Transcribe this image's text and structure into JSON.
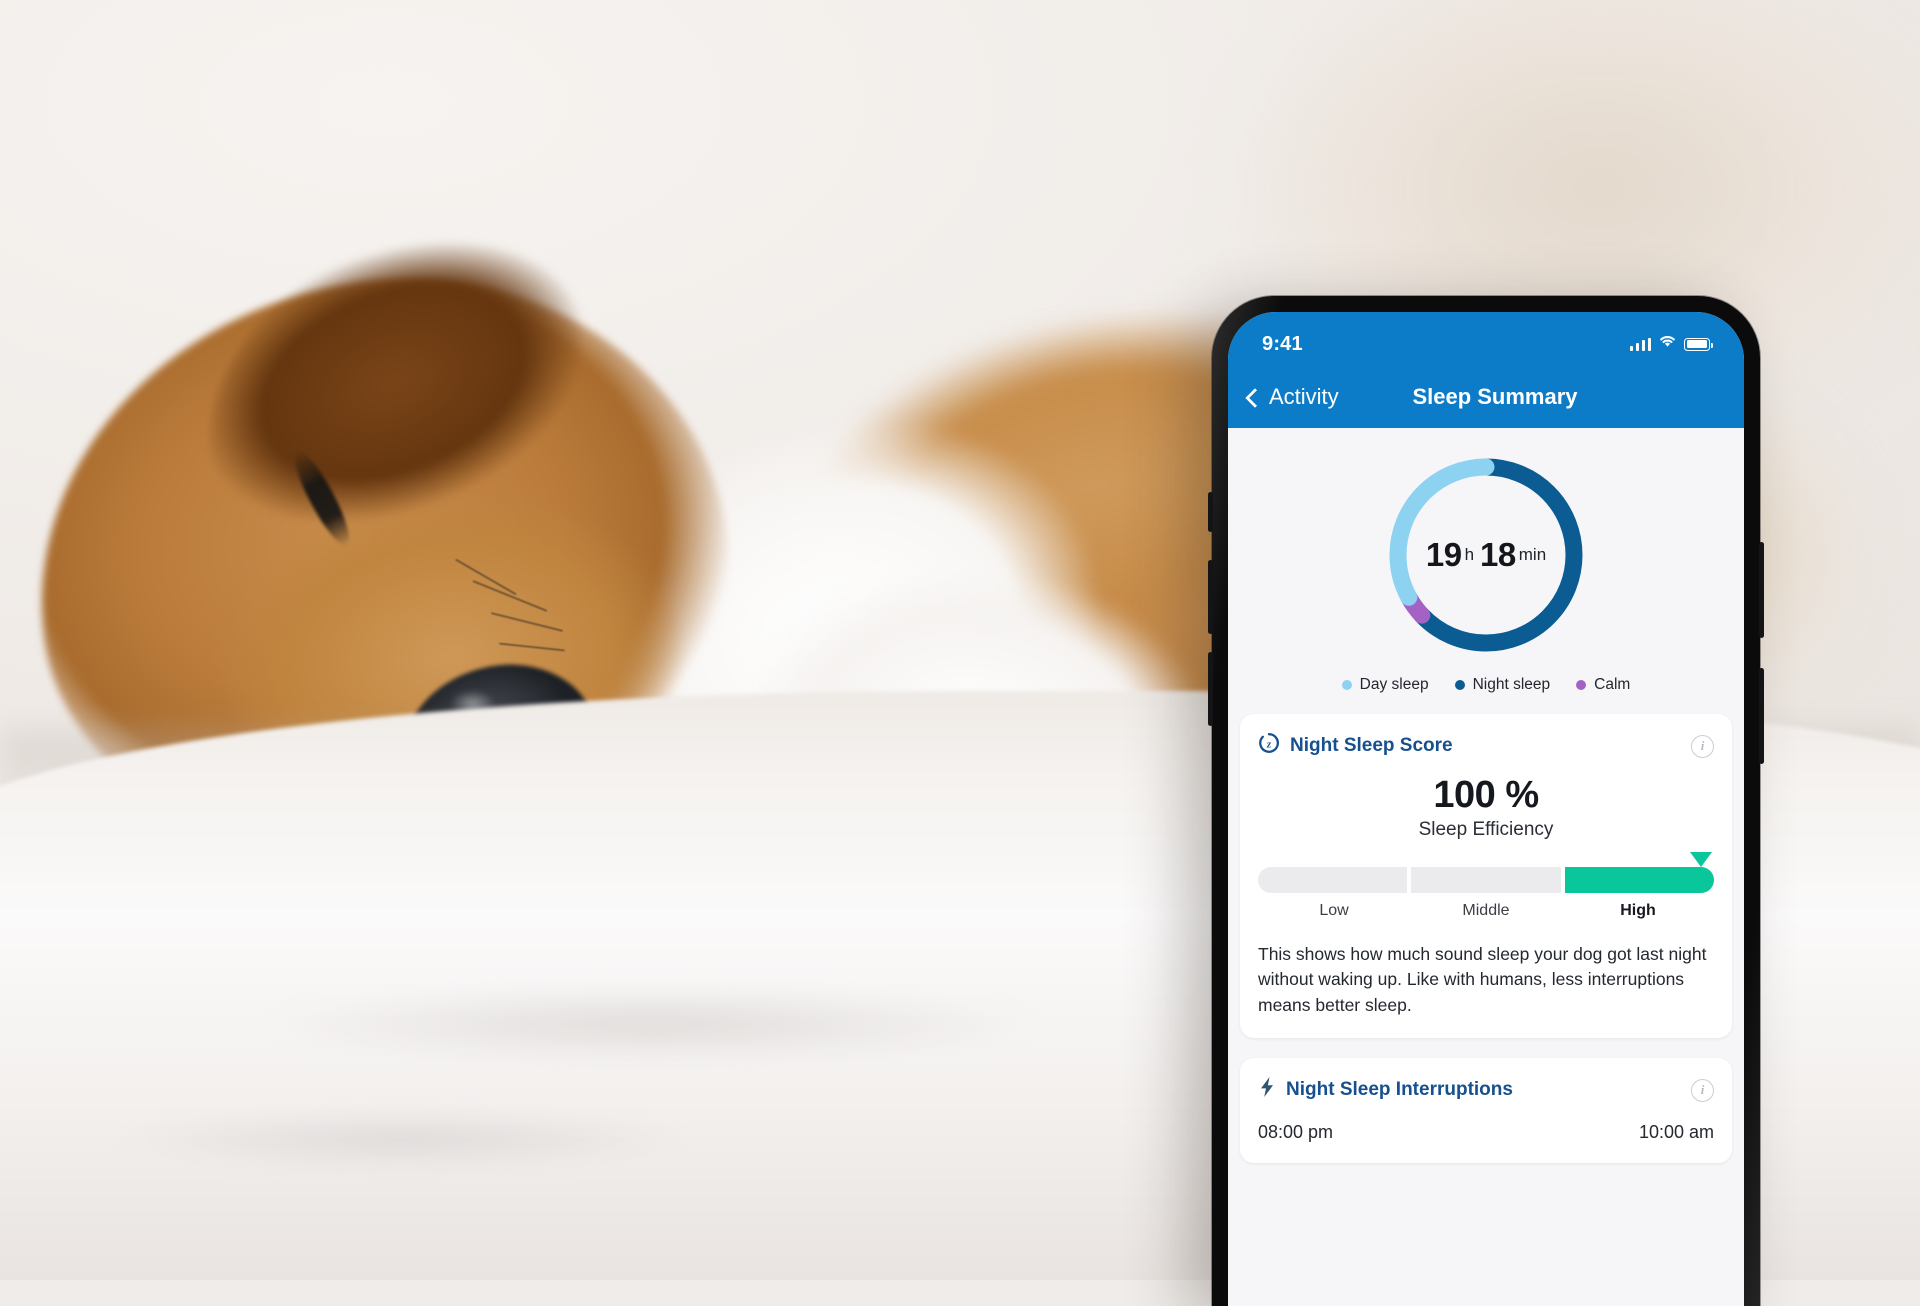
{
  "scene": {
    "description": "Sleeping brown and white dog lying on a white blanket with a smartphone showing a dog sleep tracking app",
    "subject": "sleeping-dog"
  },
  "phone": {
    "status_bar": {
      "time": "9:41",
      "cellular_icon": "signal-bars-icon",
      "wifi_icon": "wifi-icon",
      "battery_icon": "battery-icon"
    },
    "nav_bar": {
      "back_icon": "chevron-left-icon",
      "back_label": "Activity",
      "title": "Sleep Summary"
    },
    "summary": {
      "hours_value": "19",
      "hours_unit": "h",
      "minutes_value": "18",
      "minutes_unit": "min",
      "legend": [
        {
          "label": "Day sleep",
          "color": "#8ed2f2"
        },
        {
          "label": "Night sleep",
          "color": "#0b5c93"
        },
        {
          "label": "Calm",
          "color": "#a463c4"
        }
      ]
    },
    "night_sleep_score": {
      "icon": "sleep-zzz-icon",
      "title": "Night Sleep Score",
      "info_icon": "info-icon",
      "value": "100 %",
      "value_label": "Sleep Efficiency",
      "gauge": {
        "levels": [
          "Low",
          "Middle",
          "High"
        ],
        "active_level": "High",
        "active_color": "#09c79b",
        "marker_icon": "triangle-marker-icon"
      },
      "description": "This shows how much sound sleep your dog got last night without waking up. Like with humans, less interruptions means better sleep."
    },
    "night_sleep_interruptions": {
      "icon": "lightning-bolt-icon",
      "title": "Night Sleep Interruptions",
      "info_icon": "info-icon",
      "start_time": "08:00 pm",
      "end_time": "10:00 am"
    }
  },
  "chart_data": {
    "type": "pie",
    "title": "Sleep Summary donut",
    "total_label": "19 h 18 min",
    "categories": [
      "Night sleep",
      "Calm",
      "Day sleep"
    ],
    "values": [
      63,
      4,
      33
    ],
    "unit": "percent of ring",
    "colors": [
      "#0b5c93",
      "#a463c4",
      "#8ed2f2"
    ],
    "legend_position": "bottom"
  }
}
